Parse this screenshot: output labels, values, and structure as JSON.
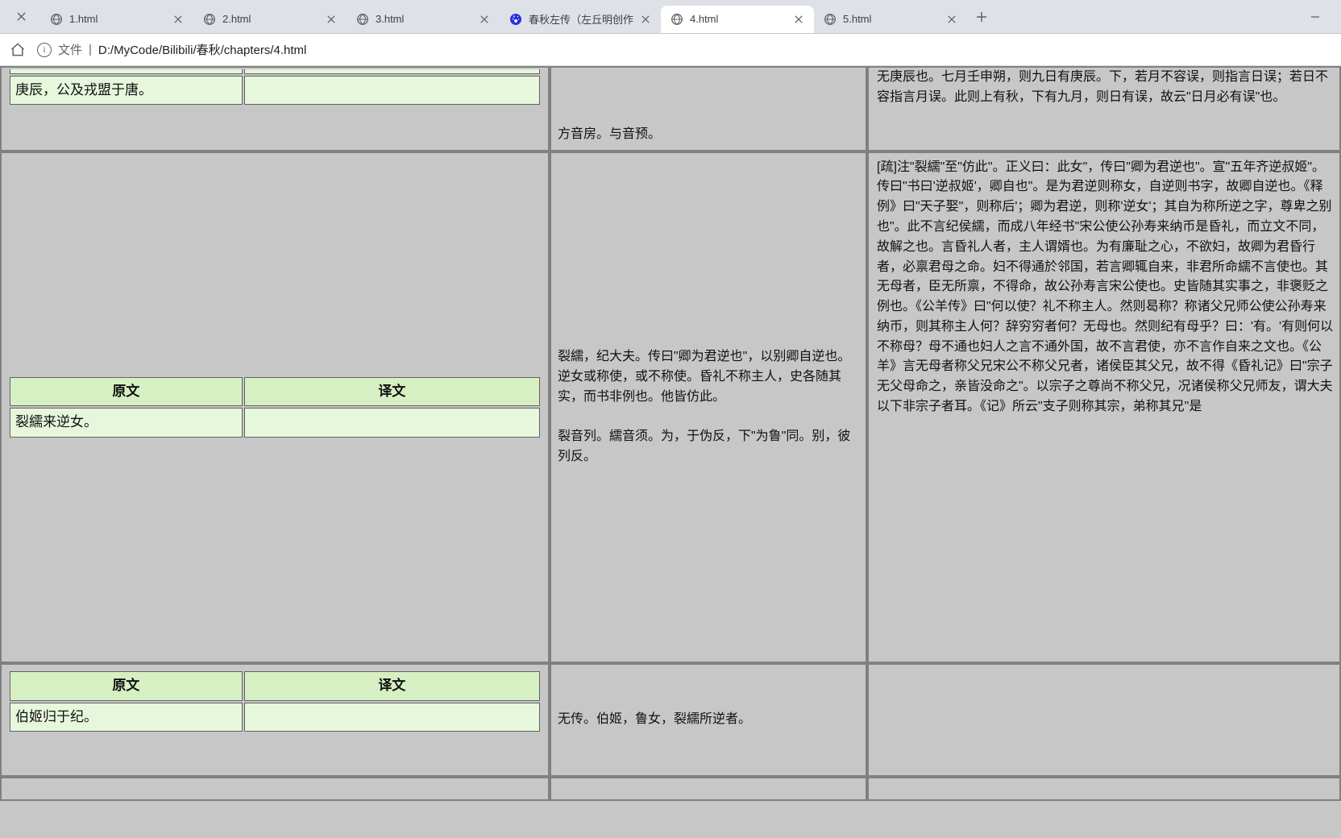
{
  "tabs": [
    {
      "label": "1.html",
      "favicon": "globe"
    },
    {
      "label": "2.html",
      "favicon": "globe"
    },
    {
      "label": "3.html",
      "favicon": "globe"
    },
    {
      "label": "春秋左传（左丘明创作",
      "favicon": "baidu"
    },
    {
      "label": "4.html",
      "favicon": "globe",
      "active": true
    },
    {
      "label": "5.html",
      "favicon": "globe"
    }
  ],
  "address": {
    "file_label": "文件",
    "path": "D:/MyCode/Bilibili/春秋/chapters/4.html"
  },
  "headers": {
    "yuanwen": "原文",
    "yiwen": "译文"
  },
  "rows": [
    {
      "yuanwen": "庚辰，公及戎盟于唐。",
      "yiwen": "",
      "mid_tail": "方音房。与音预。",
      "right_tail": "无庚辰也。七月壬申朔，则九日有庚辰。下，若月不容误，则指言日误；若日不容指言月误。此则上有秋，下有九月，则日有误，故云\"日月必有误\"也。"
    },
    {
      "yuanwen": "裂繻来逆女。",
      "yiwen": "",
      "mid": "裂繻，纪大夫。传曰\"卿为君逆也\"，以别卿自逆也。逆女或称使，或不称使。昏礼不称主人，史各随其实，而书非例也。他皆仿此。\n\n裂音列。繻音须。为，于伪反，下\"为鲁\"同。别，彼列反。",
      "right": "[疏]注\"裂繻\"至\"仿此\"。正义曰：此女\"，传曰\"卿为君逆也\"。宣\"五年齐逆叔姬\"。传曰\"书曰'逆叔姬'，卿自也\"。是为君逆则称女，自逆则书字，故卿自逆也。《释例》曰\"天子娶\"，则称后'；卿为君逆，则称'逆女'；其自为称所逆之字，尊卑之别也\"。此不言纪侯繻，而成八年经书\"宋公使公孙寿来纳币是昏礼，而立文不同，故解之也。言昏礼人者，主人谓婿也。为有廉耻之心，不欲妇，故卿为君昏行者，必禀君母之命。妇不得通於邻国，若言卿辄自来，非君所命繻不言使也。其无母者，臣无所禀，不得命，故公孙寿言宋公使也。史皆随其实事之，非褒贬之例也。《公羊传》曰\"何以使？礼不称主人。然则曷称？称诸父兄师公使公孙寿来纳币，则其称主人何？辞穷穷者何？无母也。然则纪有母乎？曰：'有。'有则何以不称母？母不通也妇人之言不通外国，故不言君使，亦不言作自来之文也。《公羊》言无母者称父兄宋公不称父兄者，诸侯臣其父兄，故不得《昏礼记》曰\"宗子无父母命之，亲皆没命之\"。以宗子之尊尚不称父兄，况诸侯称父兄师友，谓大夫以下非宗子者耳。《记》所云\"支子则称其宗，弟称其兄\"是"
    },
    {
      "yuanwen": "伯姬归于纪。",
      "yiwen": "",
      "mid": "无传。伯姬，鲁女，裂繻所逆者。",
      "right": ""
    },
    {
      "yuanwen": "",
      "yiwen": "",
      "mid": "",
      "right": ""
    }
  ]
}
